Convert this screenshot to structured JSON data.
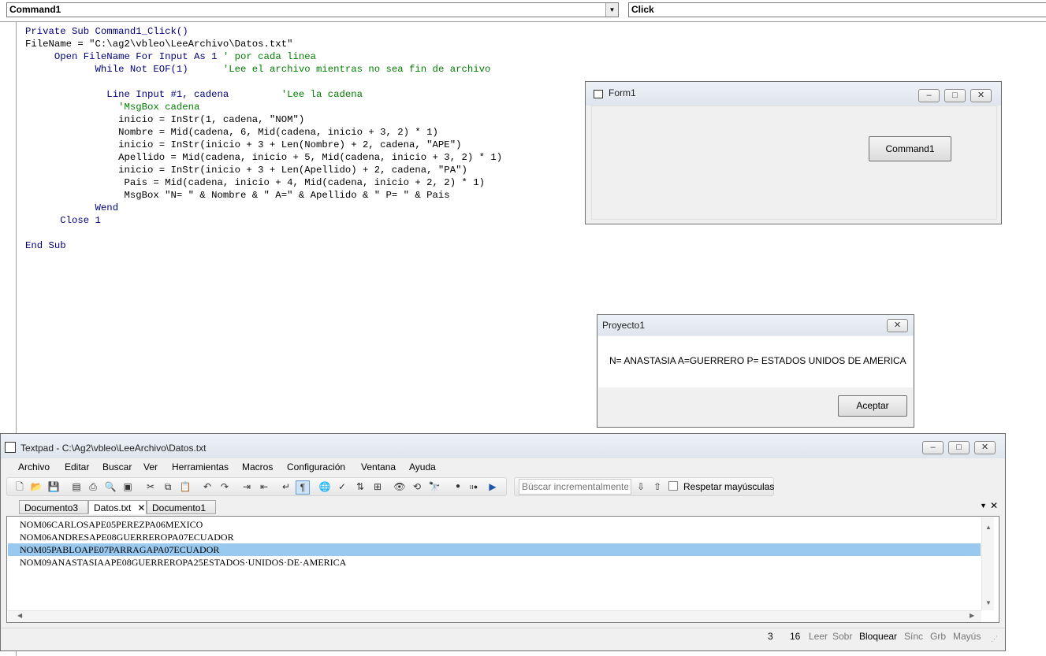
{
  "ide": {
    "object_combo": "Command1",
    "proc_combo": "Click",
    "code_lines": [
      [
        {
          "t": "Private Sub Command1_Click()",
          "c": "kw"
        }
      ],
      [
        {
          "t": "FileName = \"C:\\ag2\\vbleo\\LeeArchivo\\Datos.txt\"",
          "c": ""
        }
      ],
      [
        {
          "t": "     Open FileName For Input As 1 ",
          "c": "kw"
        },
        {
          "t": "' por cada linea",
          "c": "cm"
        }
      ],
      [
        {
          "t": "            While Not EOF(1)      ",
          "c": "kw"
        },
        {
          "t": "'Lee el archivo mientras no sea fin de archivo",
          "c": "cm"
        }
      ],
      [
        {
          "t": "",
          "c": ""
        }
      ],
      [
        {
          "t": "              Line Input #1, cadena         ",
          "c": "kw"
        },
        {
          "t": "'Lee la cadena",
          "c": "cm"
        }
      ],
      [
        {
          "t": "                ",
          "c": ""
        },
        {
          "t": "'MsgBox cadena",
          "c": "cm"
        }
      ],
      [
        {
          "t": "                inicio = InStr(1, cadena, \"NOM\")",
          "c": ""
        }
      ],
      [
        {
          "t": "                Nombre = Mid(cadena, 6, Mid(cadena, inicio + 3, 2) * 1)",
          "c": ""
        }
      ],
      [
        {
          "t": "                inicio = InStr(inicio + 3 + Len(Nombre) + 2, cadena, \"APE\")",
          "c": ""
        }
      ],
      [
        {
          "t": "                Apellido = Mid(cadena, inicio + 5, Mid(cadena, inicio + 3, 2) * 1)",
          "c": ""
        }
      ],
      [
        {
          "t": "                inicio = InStr(inicio + 3 + Len(Apellido) + 2, cadena, \"PA\")",
          "c": ""
        }
      ],
      [
        {
          "t": "                 Pais = Mid(cadena, inicio + 4, Mid(cadena, inicio + 2, 2) * 1)",
          "c": ""
        }
      ],
      [
        {
          "t": "                 MsgBox \"N= \" & Nombre & \" A=\" & Apellido & \" P= \" & Pais",
          "c": ""
        }
      ],
      [
        {
          "t": "            Wend",
          "c": "kw"
        }
      ],
      [
        {
          "t": "      Close 1",
          "c": "kw"
        }
      ],
      [
        {
          "t": "",
          "c": ""
        }
      ],
      [
        {
          "t": "End Sub",
          "c": "kw"
        }
      ]
    ]
  },
  "form1": {
    "title": "Form1",
    "button_label": "Command1"
  },
  "msgbox": {
    "title": "Proyecto1",
    "message": "N= ANASTASIA A=GUERRERO P= ESTADOS UNIDOS DE AMERICA",
    "ok_label": "Aceptar"
  },
  "textpad": {
    "title": "Textpad - C:\\Ag2\\vbleo\\LeeArchivo\\Datos.txt",
    "menu": [
      "Archivo",
      "Editar",
      "Buscar",
      "Ver",
      "Herramientas",
      "Macros",
      "Configuración",
      "Ventana",
      "Ayuda"
    ],
    "search_placeholder": "Búscar incrementalmente",
    "match_case_label": "Respetar mayúsculas",
    "tabs": [
      "Documento3 *",
      "Datos.txt",
      "Documento1 *"
    ],
    "lines": [
      "NOM06CARLOSAPE05PEREZPA06MEXICO",
      "NOM06ANDRESAPE08GUERREROPA07ECUADOR",
      "NOM05PABLOAPE07PARRAGAPA07ECUADOR",
      "NOM09ANASTASIAAPE08GUERREROPA25ESTADOS·UNIDOS·DE·AMERICA"
    ],
    "selected_line_index": 2,
    "status": {
      "line": "3",
      "col": "16",
      "read": "Leer",
      "ovr": "Sobr",
      "block": "Bloquear",
      "sync": "Sínc",
      "rec": "Grb",
      "caps": "Mayús"
    }
  },
  "colors": {
    "keyword": "#00007f",
    "comment": "#007f00",
    "selection": "#99c9ef"
  }
}
